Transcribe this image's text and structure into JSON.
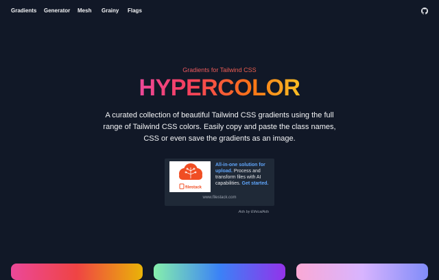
{
  "nav": {
    "items": [
      {
        "label": "Gradients"
      },
      {
        "label": "Generator"
      },
      {
        "label": "Mesh"
      },
      {
        "label": "Grainy"
      },
      {
        "label": "Flags"
      }
    ],
    "github_icon": "github-icon"
  },
  "hero": {
    "eyebrow": "Gradients for Tailwind CSS",
    "title": "HYPERCOLOR",
    "description": "A curated collection of beautiful Tailwind CSS gradients using the full range of Tailwind CSS colors. Easily copy and paste the class names, CSS or even save the gradients as an image."
  },
  "ad": {
    "headline": "All-in-one solution for upload.",
    "body": " Process and transform files with AI capabilities. ",
    "cta": "Get started.",
    "domain": "www.filestack.com",
    "by": "Ads by EthicalAds",
    "logo_text": "filestack",
    "logo_color": "#f04e23"
  },
  "cards": [
    {
      "from": "#ec4899",
      "via": "#ef4444",
      "to": "#eab308"
    },
    {
      "from": "#86efac",
      "via": "#3b82f6",
      "to": "#9333ea"
    },
    {
      "from": "#f9a8d4",
      "via": "#d8b4fe",
      "to": "#818cf8"
    }
  ]
}
